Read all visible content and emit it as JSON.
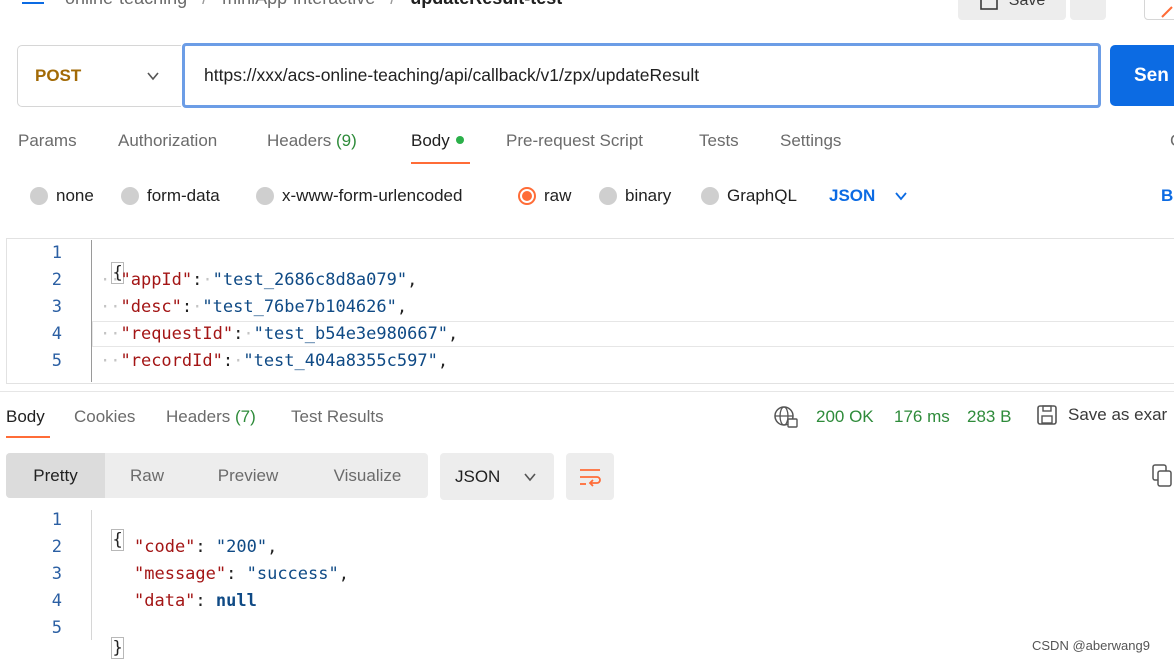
{
  "breadcrumb": {
    "items": [
      "online-teaching",
      "miniApp-interactive"
    ],
    "current": "updateResult-test"
  },
  "toolbar": {
    "save_label": "Save"
  },
  "request": {
    "method": "POST",
    "url": "https://xxx/acs-online-teaching/api/callback/v1/zpx/updateResult",
    "send_label": "Sen"
  },
  "request_tabs": {
    "params": "Params",
    "authorization": "Authorization",
    "headers": "Headers",
    "headers_count": "(9)",
    "body": "Body",
    "pre_request": "Pre-request Script",
    "tests": "Tests",
    "settings": "Settings",
    "right_partial": "C"
  },
  "body_types": {
    "none": "none",
    "form_data": "form-data",
    "urlencoded": "x-www-form-urlencoded",
    "raw": "raw",
    "binary": "binary",
    "graphql": "GraphQL",
    "selected": "raw",
    "language": "JSON",
    "beautify_partial": "B"
  },
  "request_body": {
    "line_numbers": [
      "1",
      "2",
      "3",
      "4",
      "5"
    ],
    "lines": [
      {
        "key": "",
        "value": ""
      },
      {
        "key": "\"appId\"",
        "value": "\"test_2686c8d8a079\""
      },
      {
        "key": "\"desc\"",
        "value": "\"test_76be7b104626\""
      },
      {
        "key": "\"requestId\"",
        "value": "\"test_b54e3e980667\""
      },
      {
        "key": "\"recordId\"",
        "value": "\"test_404a8355c597\""
      }
    ],
    "open_brace": "{"
  },
  "response_tabs": {
    "body": "Body",
    "cookies": "Cookies",
    "headers": "Headers",
    "headers_count": "(7)",
    "test_results": "Test Results"
  },
  "response_meta": {
    "status": "200 OK",
    "time": "176 ms",
    "size": "283 B",
    "save_example": "Save as exar"
  },
  "response_view": {
    "pretty": "Pretty",
    "raw": "Raw",
    "preview": "Preview",
    "visualize": "Visualize",
    "language": "JSON"
  },
  "response_body": {
    "line_numbers": [
      "1",
      "2",
      "3",
      "4",
      "5"
    ],
    "open_brace": "{",
    "close_brace": "}",
    "code_key": "\"code\"",
    "code_value": "\"200\"",
    "message_key": "\"message\"",
    "message_value": "\"success\"",
    "data_key": "\"data\"",
    "data_value": "null"
  },
  "watermark": "CSDN @aberwang9",
  "colors": {
    "accent_orange": "#ff6c37",
    "send_blue": "#0c6be3",
    "status_green": "#2e8b3a",
    "method_post": "#a26a06"
  }
}
